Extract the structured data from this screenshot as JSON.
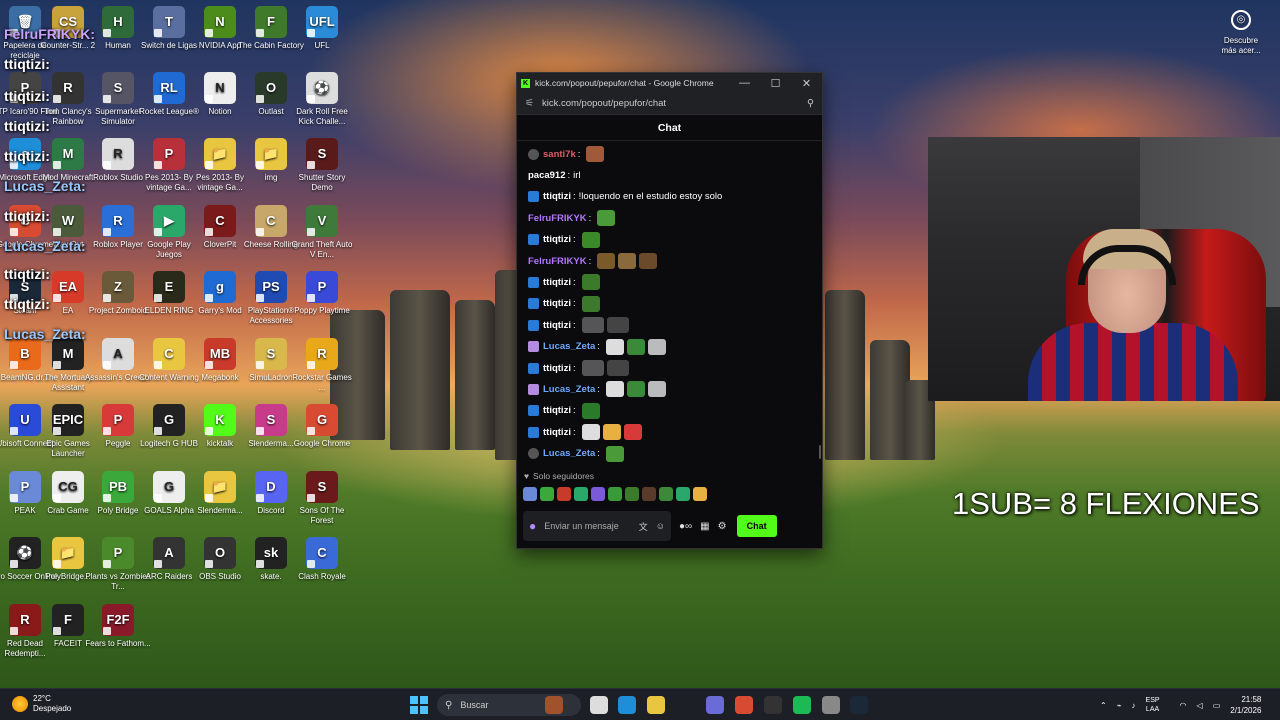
{
  "desktop_icons": [
    {
      "label": "Papelera de reciclaje",
      "color": "#3a6ea5",
      "glyph": "🗑"
    },
    {
      "label": "Counter-Str... 2",
      "color": "#c8a23a",
      "glyph": "CS"
    },
    {
      "label": "Human",
      "color": "#2f6b3a",
      "glyph": "H"
    },
    {
      "label": "Switch de Ligas",
      "color": "#5a6fa0",
      "glyph": "T"
    },
    {
      "label": "NVIDIA App",
      "color": "#4c8c1a",
      "glyph": "N"
    },
    {
      "label": "The Cabin Factory",
      "color": "#3f7a2a",
      "glyph": "F"
    },
    {
      "label": "UFL",
      "color": "#2a8bd8",
      "glyph": "UFL"
    },
    {
      "label": "PTP Icaro'90 Final",
      "color": "#444",
      "glyph": "P"
    },
    {
      "label": "Tom Clancy's Rainbow",
      "color": "#333",
      "glyph": "R"
    },
    {
      "label": "Supermarket Simulator",
      "color": "#556",
      "glyph": "S"
    },
    {
      "label": "Rocket League®",
      "color": "#1f6bd3",
      "glyph": "RL"
    },
    {
      "label": "Notion",
      "color": "#eeeeee",
      "glyph": "N"
    },
    {
      "label": "Outlast",
      "color": "#2a3a2a",
      "glyph": "O"
    },
    {
      "label": "Dark Roll Free Kick Challe...",
      "color": "#ddd",
      "glyph": "⚽"
    },
    {
      "label": "Microsoft Edge",
      "color": "#1f8ed8",
      "glyph": "e"
    },
    {
      "label": "Mod Minecraft",
      "color": "#2e7a46",
      "glyph": "M"
    },
    {
      "label": "Roblox Studio",
      "color": "#ddd",
      "glyph": "R"
    },
    {
      "label": "Pes 2013- By vintage Ga...",
      "color": "#b8303a",
      "glyph": "P"
    },
    {
      "label": "Pes 2013- By vintage Ga...",
      "color": "#e8c640",
      "glyph": "📁"
    },
    {
      "label": "img",
      "color": "#e8c640",
      "glyph": "📁"
    },
    {
      "label": "Shutter Story Demo",
      "color": "#5a1a1a",
      "glyph": "S"
    },
    {
      "label": "Google Chrome",
      "color": "#d84a32",
      "glyph": "G"
    },
    {
      "label": "Way Out",
      "color": "#4a5a3a",
      "glyph": "W"
    },
    {
      "label": "Roblox Player",
      "color": "#2a6ed8",
      "glyph": "R"
    },
    {
      "label": "Google Play Juegos",
      "color": "#2aa86a",
      "glyph": "▶"
    },
    {
      "label": "CloverPit",
      "color": "#7a1a1a",
      "glyph": "C"
    },
    {
      "label": "Cheese Rolling",
      "color": "#c8a86a",
      "glyph": "C"
    },
    {
      "label": "Grand Theft Auto V En...",
      "color": "#3f7a3a",
      "glyph": "V"
    },
    {
      "label": "Steam",
      "color": "#1b2838",
      "glyph": "S"
    },
    {
      "label": "EA",
      "color": "#d83a2a",
      "glyph": "EA"
    },
    {
      "label": "Project Zomboid",
      "color": "#6a5a3a",
      "glyph": "Z"
    },
    {
      "label": "ELDEN RING",
      "color": "#2a2a1a",
      "glyph": "E"
    },
    {
      "label": "Garry's Mod",
      "color": "#1f6bd3",
      "glyph": "g"
    },
    {
      "label": "PlayStation® Accessories",
      "color": "#1f4bb3",
      "glyph": "PS"
    },
    {
      "label": "Poppy Playtime",
      "color": "#3a4ad8",
      "glyph": "P"
    },
    {
      "label": "BeamNG.dr...",
      "color": "#e86a1a",
      "glyph": "B"
    },
    {
      "label": "The Mortuary Assistant",
      "color": "#222",
      "glyph": "M"
    },
    {
      "label": "Assassin's Creed I",
      "color": "#ddd",
      "glyph": "A"
    },
    {
      "label": "Content Warning",
      "color": "#e8c640",
      "glyph": "C"
    },
    {
      "label": "Megabonk",
      "color": "#c83a2a",
      "glyph": "MB"
    },
    {
      "label": "SimuLadron",
      "color": "#d8b84a",
      "glyph": "S"
    },
    {
      "label": "Rockstar Games ...",
      "color": "#e8a81a",
      "glyph": "R"
    },
    {
      "label": "Ubisoft Connect",
      "color": "#2a4ad8",
      "glyph": "U"
    },
    {
      "label": "Epic Games Launcher",
      "color": "#222",
      "glyph": "EPIC"
    },
    {
      "label": "Peggle",
      "color": "#d83a3a",
      "glyph": "P"
    },
    {
      "label": "Logitech G HUB",
      "color": "#222",
      "glyph": "G"
    },
    {
      "label": "kicktalk",
      "color": "#53fc18",
      "glyph": "K"
    },
    {
      "label": "Slenderma...",
      "color": "#c83a8a",
      "glyph": "S"
    },
    {
      "label": "Google Chrome",
      "color": "#d84a32",
      "glyph": "G"
    },
    {
      "label": "PEAK",
      "color": "#6a8ad8",
      "glyph": "P"
    },
    {
      "label": "Crab Game",
      "color": "#eeeeee",
      "glyph": "CG"
    },
    {
      "label": "Poly Bridge",
      "color": "#3aa83a",
      "glyph": "PB"
    },
    {
      "label": "GOALS Alpha",
      "color": "#eeeeee",
      "glyph": "G"
    },
    {
      "label": "Slenderma...",
      "color": "#e8c640",
      "glyph": "📁"
    },
    {
      "label": "Discord",
      "color": "#5865f2",
      "glyph": "D"
    },
    {
      "label": "Sons Of The Forest",
      "color": "#6a1a1a",
      "glyph": "S"
    },
    {
      "label": "Pro Soccer Online",
      "color": "#222",
      "glyph": "⚽"
    },
    {
      "label": "PolyBridge...",
      "color": "#e8c640",
      "glyph": "📁"
    },
    {
      "label": "Plants vs Zombies Tr...",
      "color": "#4a8a2a",
      "glyph": "P"
    },
    {
      "label": "ARC Raiders",
      "color": "#333",
      "glyph": "A"
    },
    {
      "label": "OBS Studio",
      "color": "#333",
      "glyph": "O"
    },
    {
      "label": "skate.",
      "color": "#222",
      "glyph": "sk"
    },
    {
      "label": "Clash Royale",
      "color": "#3a6ad8",
      "glyph": "C"
    },
    {
      "label": "Red Dead Redempti...",
      "color": "#8a1a1a",
      "glyph": "R"
    },
    {
      "label": "FACEIT",
      "color": "#222",
      "glyph": "F"
    },
    {
      "label": "Fears to Fathom...",
      "color": "#8a1a2a",
      "glyph": "F2F"
    }
  ],
  "overlay_names": [
    {
      "text": "FelruFRIKYK:",
      "style": "purple"
    },
    {
      "text": "ttiqtizi:",
      "style": "plain"
    },
    {
      "text": "ttiqtizi:",
      "style": "plain"
    },
    {
      "text": "ttiqtizi:",
      "style": "plain"
    },
    {
      "text": "ttiqtizi:",
      "style": "plain"
    },
    {
      "text": "Lucas_Zeta:",
      "style": "blue"
    },
    {
      "text": "ttiqtizi:",
      "style": "plain"
    },
    {
      "text": "Lucas_Zeta:",
      "style": "blue"
    },
    {
      "text": "ttiqtizi:",
      "style": "plain"
    },
    {
      "text": "ttiqtizi:",
      "style": "plain"
    },
    {
      "text": "Lucas_Zeta:",
      "style": "blue"
    }
  ],
  "browser": {
    "window_title": "kick.com/popout/pepufor/chat - Google Chrome",
    "url": "kick.com/popout/pepufor/chat",
    "minimize": "—",
    "maximize": "☐",
    "close": "✕"
  },
  "chat": {
    "header": "Chat",
    "messages": [
      {
        "user": "santi7k",
        "user_color": "#e05a6a",
        "badge": "gray",
        "text": "",
        "emotes": [
          "#a05a3a"
        ]
      },
      {
        "user": "paca912",
        "user_color": "#ffffff",
        "badge": "none",
        "text": "irl",
        "emotes": []
      },
      {
        "user": "ttiqtizi",
        "user_color": "#ffffff",
        "badge": "twitch",
        "text": "!loquendo en el estudio estoy solo",
        "emotes": []
      },
      {
        "user": "FelruFRIKYK",
        "user_color": "#b276ff",
        "badge": "none",
        "text": "",
        "emotes": [
          "#4a9a3a"
        ]
      },
      {
        "user": "ttiqtizi",
        "user_color": "#ffffff",
        "badge": "twitch",
        "text": "",
        "emotes": [
          "#3a8a2a"
        ]
      },
      {
        "user": "FelruFRIKYK",
        "user_color": "#b276ff",
        "badge": "none",
        "text": "",
        "emotes": [
          "#7a5a2a",
          "#8a6a3a",
          "#6a4a2a"
        ]
      },
      {
        "user": "ttiqtizi",
        "user_color": "#ffffff",
        "badge": "twitch",
        "text": "",
        "emotes": [
          "#3a7a2a"
        ]
      },
      {
        "user": "ttiqtizi",
        "user_color": "#ffffff",
        "badge": "twitch",
        "text": "",
        "emotes": [
          "#3a7a2a"
        ]
      },
      {
        "user": "ttiqtizi",
        "user_color": "#ffffff",
        "badge": "twitch",
        "text": "",
        "emotes": [
          "#555555",
          "#444444"
        ]
      },
      {
        "user": "Lucas_Zeta",
        "user_color": "#6fa8ff",
        "badge": "sub",
        "text": "",
        "emotes": [
          "#dddddd",
          "#3a8a3a",
          "#bbbbbb"
        ]
      },
      {
        "user": "ttiqtizi",
        "user_color": "#ffffff",
        "badge": "twitch",
        "text": "",
        "emotes": [
          "#555555",
          "#444444"
        ]
      },
      {
        "user": "Lucas_Zeta",
        "user_color": "#6fa8ff",
        "badge": "sub",
        "text": "",
        "emotes": [
          "#dddddd",
          "#3a8a3a",
          "#bbbbbb"
        ]
      },
      {
        "user": "ttiqtizi",
        "user_color": "#ffffff",
        "badge": "twitch",
        "text": "",
        "emotes": [
          "#2a7a2a"
        ]
      },
      {
        "user": "ttiqtizi",
        "user_color": "#ffffff",
        "badge": "twitch",
        "text": "",
        "emotes": [
          "#dddddd",
          "#e8b040",
          "#d83a3a"
        ]
      },
      {
        "user": "Lucas_Zeta",
        "user_color": "#6fa8ff",
        "badge": "gray",
        "text": "",
        "emotes": [
          "#4a9a3a"
        ]
      }
    ],
    "followers_only": "Solo seguidores",
    "emote_bar_colors": [
      "#6a8ad8",
      "#3aa83a",
      "#c83a2a",
      "#2aa86a",
      "#7a5ad8",
      "#3a9a3a",
      "#3a7a2a",
      "#5a3a2a",
      "#3a8a3a",
      "#2aa86a",
      "#e8b040"
    ],
    "input_placeholder": "Enviar un mensaje",
    "send_label": "Chat"
  },
  "stream_overlay_text": "1SUB= 8 FLEXIONES",
  "discover": {
    "label": "Descubre más acer..."
  },
  "taskbar": {
    "temperature": "22°C",
    "weather": "Despejado",
    "search_placeholder": "Buscar",
    "lang_top": "ESP",
    "lang_bottom": "LAA",
    "time": "21:58",
    "date": "2/1/2026",
    "apps": [
      "#a0522d",
      "#dddddd",
      "#1f8ed8",
      "#e8c640",
      "#6b6bd8",
      "#d84a32",
      "#333333",
      "#1db954",
      "#888888",
      "#1b2838"
    ]
  }
}
